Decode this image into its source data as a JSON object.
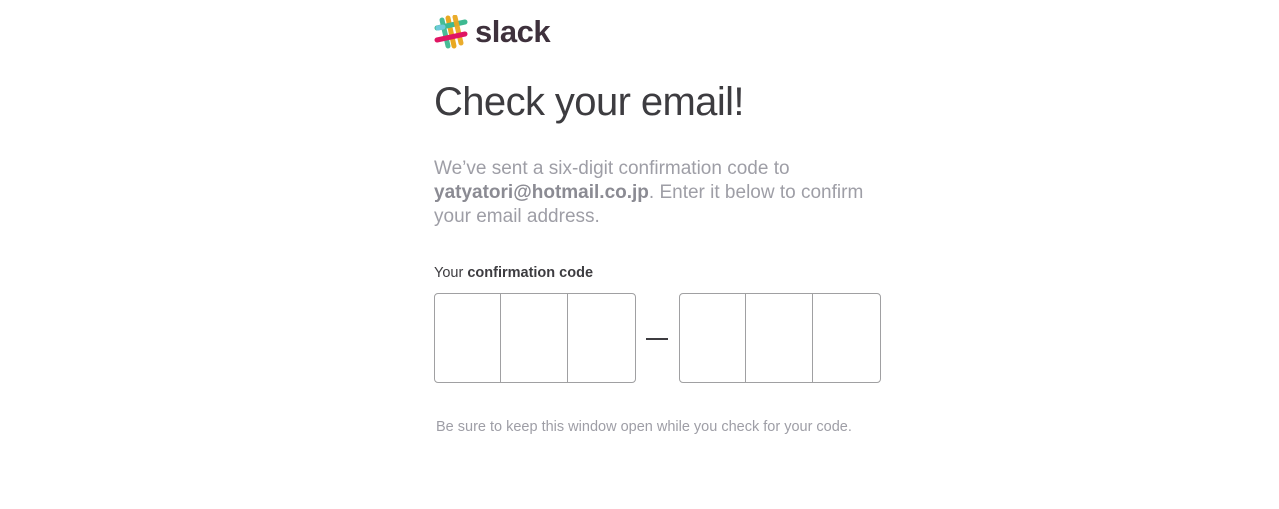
{
  "brand": {
    "name": "slack",
    "colors": {
      "wordmark": "#3e313c",
      "teal": "#3eb991",
      "yellow": "#e9a820",
      "blue": "#6ecadc",
      "pink": "#e01563"
    }
  },
  "heading": "Check your email!",
  "description": {
    "prefix": "We’ve sent a six-digit confirmation code to",
    "email": "yatyatori@hotmail.co.jp",
    "suffix": ". Enter it below to confirm your email address."
  },
  "code": {
    "label_prefix": "Your",
    "label_bold": "confirmation code",
    "separator": "–",
    "digits": [
      "",
      "",
      "",
      "",
      "",
      ""
    ]
  },
  "note": "Be sure to keep this window open while you check for your code."
}
